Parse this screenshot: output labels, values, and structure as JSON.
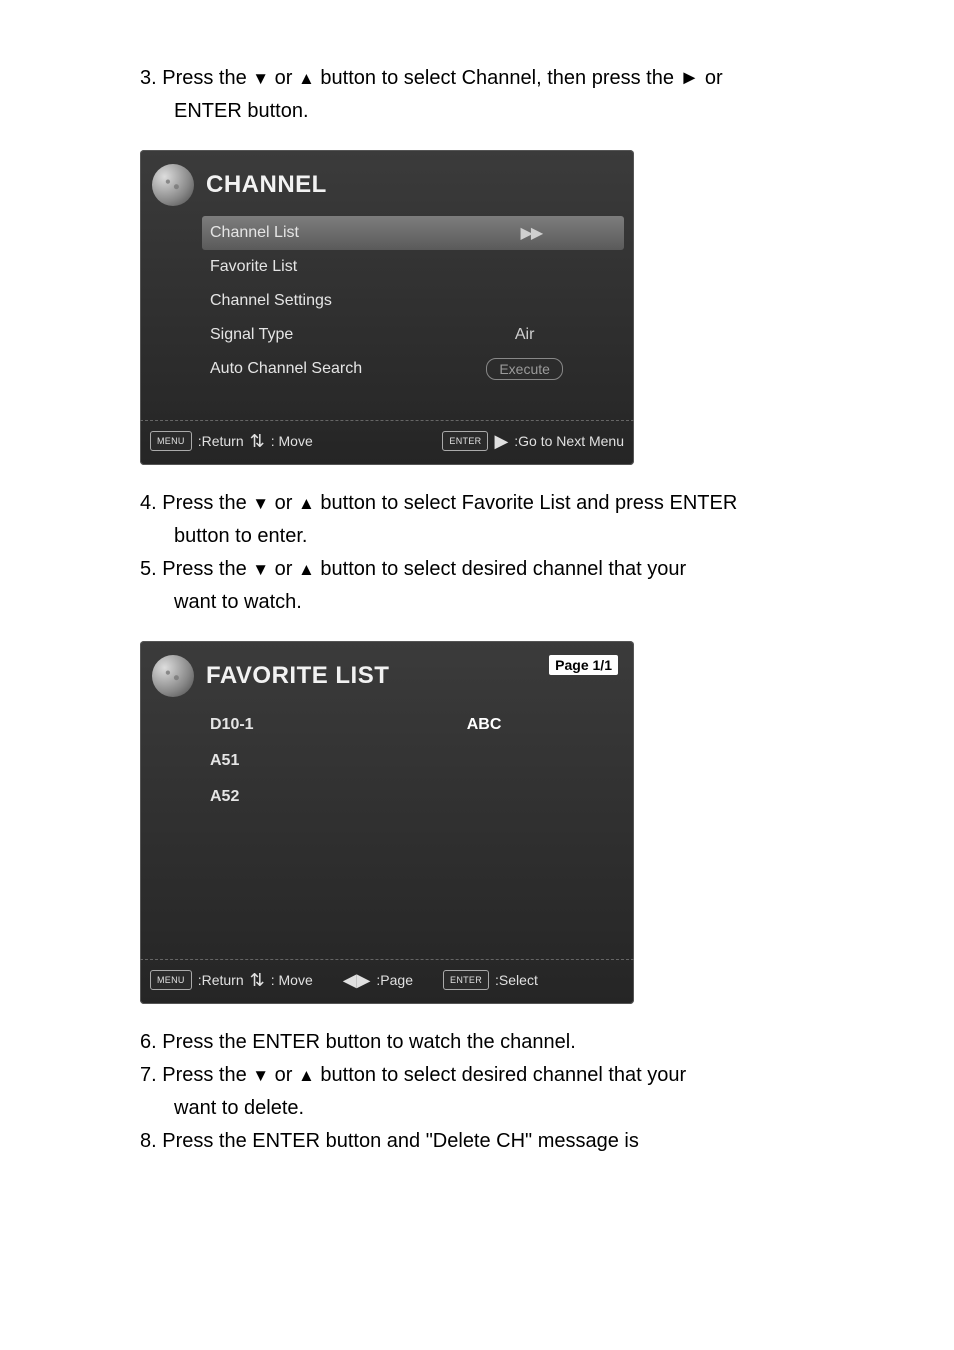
{
  "intro_line_prefix": "3. Press the ",
  "glyphs": {
    "down": "▼",
    "up": "▲"
  },
  "intro_line_mid": " or ",
  "intro_line_suffix": " button to select Channel, then press the ► or",
  "intro_line2": "ENTER button.",
  "channel_menu": {
    "title": "CHANNEL",
    "items": [
      {
        "label": "Channel List",
        "value_type": "arrows"
      },
      {
        "label": "Favorite List",
        "value": ""
      },
      {
        "label": "Channel Settings",
        "value": ""
      },
      {
        "label": "Signal Type",
        "value": "Air"
      },
      {
        "label": "Auto Channel Search",
        "value_type": "exec",
        "value": "Execute"
      }
    ],
    "legend": {
      "menu_key": "MENU",
      "return": ":Return",
      "move": ": Move",
      "enter_key": "ENTER",
      "next": ":Go to Next Menu"
    }
  },
  "step4_prefix": "4. Press the ",
  "step4_suffix": " button to select Favorite List and press ENTER",
  "step4_line2": "button to enter.",
  "step5_prefix": "5. Press the ",
  "step5_suffix": " button to select desired channel that your",
  "step5_line2": "want to watch.",
  "fav_menu": {
    "title": "FAVORITE LIST",
    "page": "Page 1/1",
    "rows": [
      {
        "ch": "D10-1",
        "name": "ABC"
      },
      {
        "ch": "A51",
        "name": ""
      },
      {
        "ch": "A52",
        "name": ""
      }
    ],
    "legend": {
      "menu_key": "MENU",
      "return": ":Return",
      "move": ": Move",
      "page_nav": ":Page",
      "enter_key": "ENTER",
      "select": ":Select"
    }
  },
  "step6_line1": "6. Press the ENTER button to watch the channel.",
  "step7_prefix": "7. Press the ",
  "step7_suffix": " button to select desired channel that your",
  "step7_line2": "want to delete.",
  "step8_line1": "8. Press the ENTER button and \"Delete CH\" message is"
}
